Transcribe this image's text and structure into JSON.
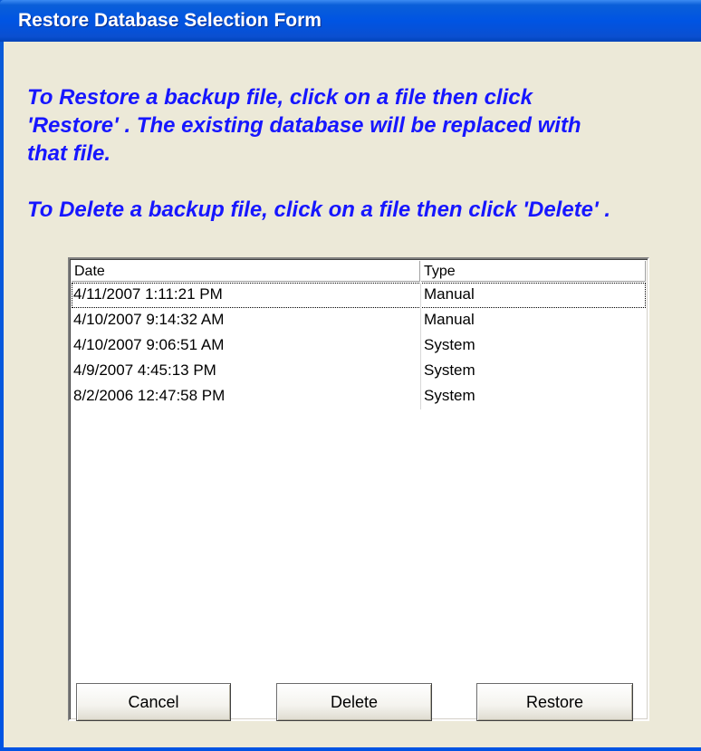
{
  "window": {
    "title": "Restore Database Selection Form"
  },
  "instructions": {
    "restore_line1": "To Restore a backup file, click on a file then click",
    "restore_line2": "'Restore' . The existing database will be replaced with",
    "restore_line3": "that file.",
    "delete_line": "To Delete a backup file, click on a file then click 'Delete' ."
  },
  "backups": {
    "columns": [
      "Date",
      "Type"
    ],
    "rows": [
      {
        "date": "4/11/2007 1:11:21 PM",
        "type": "Manual",
        "selected": true
      },
      {
        "date": "4/10/2007 9:14:32 AM",
        "type": "Manual",
        "selected": false
      },
      {
        "date": "4/10/2007 9:06:51 AM",
        "type": "System",
        "selected": false
      },
      {
        "date": "4/9/2007 4:45:13 PM",
        "type": "System",
        "selected": false
      },
      {
        "date": "8/2/2006 12:47:58 PM",
        "type": "System",
        "selected": false
      }
    ]
  },
  "buttons": {
    "cancel": "Cancel",
    "delete": "Delete",
    "restore": "Restore"
  },
  "colors": {
    "title_bar": "#0054e3",
    "client_background": "#ece9d8",
    "instruction_text": "#1616ff"
  }
}
